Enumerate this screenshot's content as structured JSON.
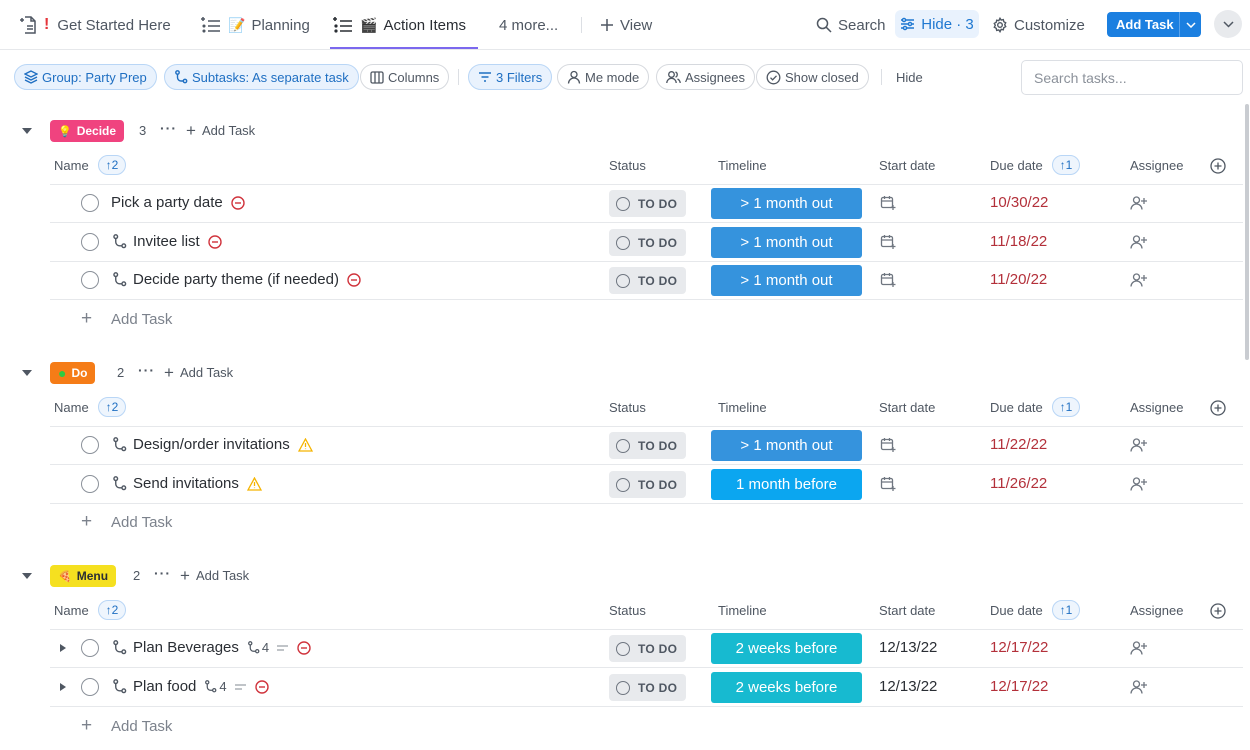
{
  "tabs": [
    {
      "label": "Get Started Here",
      "prefix": "!"
    },
    {
      "label": "Planning",
      "emoji": "📝"
    },
    {
      "label": "Action Items",
      "emoji": "🎬"
    },
    {
      "label": "4 more..."
    }
  ],
  "toolbar": {
    "add_view_label": "View",
    "search_label": "Search",
    "hide_label": "Hide · 3",
    "customize_label": "Customize",
    "add_task_label": "Add Task"
  },
  "filters": {
    "group_label": "Group: Party Prep",
    "subtasks_label": "Subtasks: As separate task",
    "columns_label": "Columns",
    "filters_label": "3 Filters",
    "me_mode_label": "Me mode",
    "assignees_label": "Assignees",
    "show_closed_label": "Show closed",
    "hide_label": "Hide",
    "search_placeholder": "Search tasks..."
  },
  "columns": {
    "name": "Name",
    "name_sort": "2",
    "status": "Status",
    "timeline": "Timeline",
    "start_date": "Start date",
    "due_date": "Due date",
    "due_sort": "1",
    "assignee": "Assignee"
  },
  "add_task_label": "Add Task",
  "colors": {
    "decide": "#f0437f",
    "do": "#f57c17",
    "menu": "#f5e020",
    "timeline_month_out": "#3593dd",
    "timeline_month_before": "#0ba6f0",
    "timeline_weeks_before": "#17bad0",
    "due_text": "#b3303a",
    "priority_red": "#d0333c",
    "priority_yellow": "#f5b400"
  },
  "groups": [
    {
      "name": "Decide",
      "emoji": "💡",
      "count": "3",
      "tasks": [
        {
          "name": "Pick a party date",
          "status": "TO DO",
          "timeline": "> 1 month out",
          "start": "",
          "due": "10/30/22",
          "subtask": false,
          "priority": "minus"
        },
        {
          "name": "Invitee list",
          "status": "TO DO",
          "timeline": "> 1 month out",
          "start": "",
          "due": "11/18/22",
          "subtask": true,
          "priority": "minus"
        },
        {
          "name": "Decide party theme (if needed)",
          "status": "TO DO",
          "timeline": "> 1 month out",
          "start": "",
          "due": "11/20/22",
          "subtask": true,
          "priority": "minus"
        }
      ]
    },
    {
      "name": "Do",
      "emoji": "●",
      "count": "2",
      "tasks": [
        {
          "name": "Design/order invitations",
          "status": "TO DO",
          "timeline": "> 1 month out",
          "start": "",
          "due": "11/22/22",
          "subtask": true,
          "priority": "warning"
        },
        {
          "name": "Send invitations",
          "status": "TO DO",
          "timeline": "1 month before",
          "start": "",
          "due": "11/26/22",
          "subtask": true,
          "priority": "warning"
        }
      ]
    },
    {
      "name": "Menu",
      "emoji": "🍕",
      "count": "2",
      "tasks": [
        {
          "name": "Plan Beverages",
          "status": "TO DO",
          "timeline": "2 weeks before",
          "start": "12/13/22",
          "due": "12/17/22",
          "subtask": true,
          "subcount": "4",
          "priority": "minus"
        },
        {
          "name": "Plan food",
          "status": "TO DO",
          "timeline": "2 weeks before",
          "start": "12/13/22",
          "due": "12/17/22",
          "subtask": true,
          "subcount": "4",
          "priority": "minus"
        }
      ]
    }
  ]
}
